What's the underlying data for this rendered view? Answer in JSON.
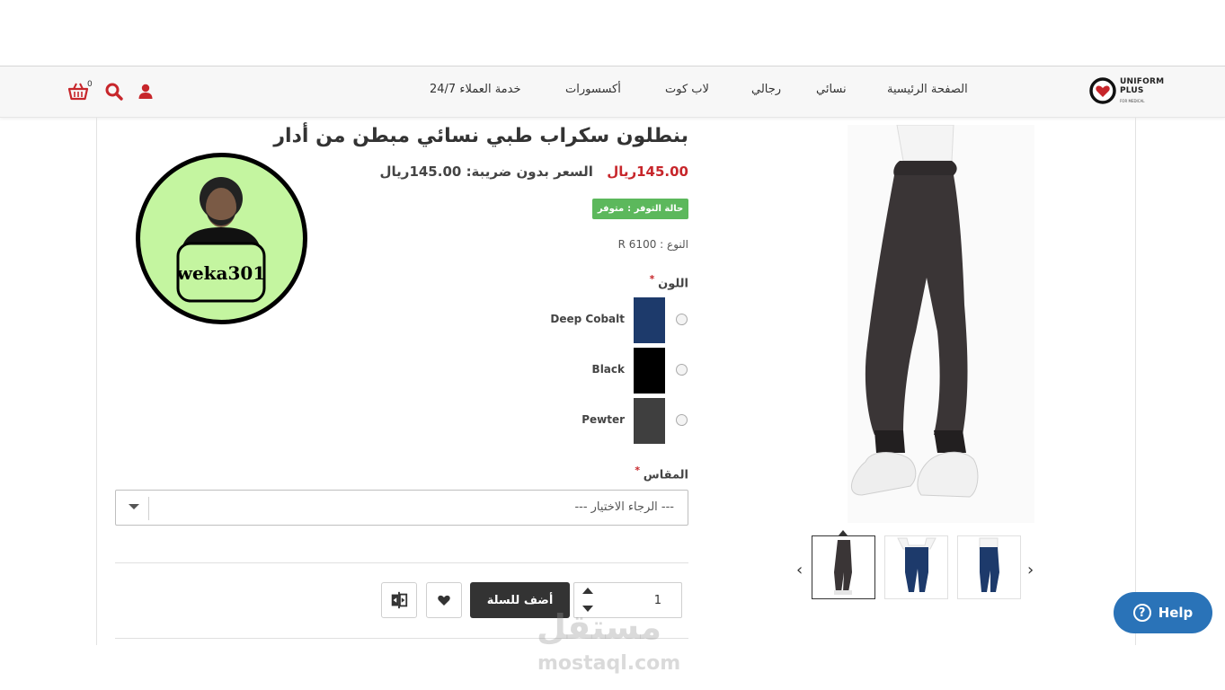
{
  "header": {
    "logo": {
      "line1": "UNIFORM",
      "line2": "PLUS",
      "tag": "FOR MEDICAL"
    },
    "nav": [
      "الصفحة الرئيسية",
      "نسائي",
      "رجالي",
      "لاب كوت",
      "أكسسورات",
      "خدمة العملاء 24/7"
    ],
    "cart_count": "0",
    "icons": [
      "user-icon",
      "search-icon",
      "cart-icon"
    ]
  },
  "product": {
    "title": "بنطلون سكراب طبي نسائي مبطن من أدار",
    "price": "145.00ريال",
    "tax_label": "السعر بدون ضريبة:",
    "tax_price": "145.00ريال",
    "stock_label": "حالة التوفر :",
    "stock_value": "متوفر",
    "model_label": "النوع :",
    "model_value": "R 6100",
    "color_label": "اللون",
    "colors": [
      {
        "name": "Deep Cobalt",
        "hex": "#1d3a6b"
      },
      {
        "name": "Black",
        "hex": "#000000"
      },
      {
        "name": "Pewter",
        "hex": "#3f3f3f"
      }
    ],
    "size_label": "المقاس",
    "size_placeholder": "--- الرجاء الاختيار ---",
    "quantity": "1",
    "add_to_cart": "أضف للسلة"
  },
  "avatar": {
    "name": "weka301",
    "bg": "#c4f5a0"
  },
  "help": {
    "label": "Help"
  },
  "watermark": {
    "arabic": "مستقل",
    "latin": "mostaql.com"
  },
  "colors": {
    "accent": "#c7262b",
    "stock_bg": "#5cb85c",
    "help_bg": "#2a73b8"
  }
}
